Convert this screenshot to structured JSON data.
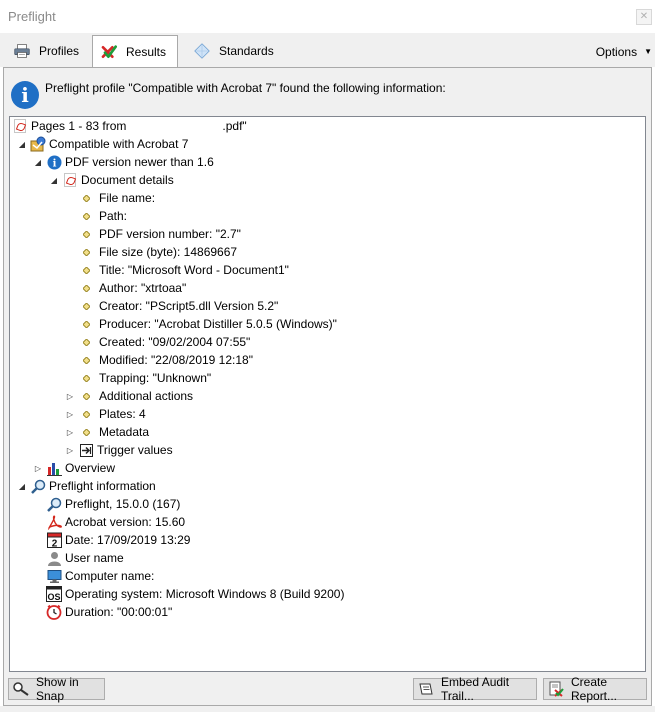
{
  "window": {
    "title": "Preflight"
  },
  "tabs": [
    {
      "label": "Profiles",
      "icon": "printer-icon"
    },
    {
      "label": "Results",
      "icon": "checkmark-cross-icon"
    },
    {
      "label": "Standards",
      "icon": "diamond-icon"
    }
  ],
  "options_label": "Options",
  "info_message": "Preflight profile \"Compatible with Acrobat 7\" found the following information:",
  "tree": {
    "root": {
      "label": "Pages 1 - 83 from",
      "file_suffix": ".pdf\""
    },
    "profile": "Compatible with Acrobat 7",
    "check": "PDF version newer than 1.6",
    "doc_details": "Document details",
    "details": [
      "File name:",
      "Path:",
      "PDF version number: \"2.7\"",
      "File size (byte): 14869667",
      "Title: \"Microsoft Word - Document1\"",
      "Author: \"xtrtoaa\"",
      "Creator: \"PScript5.dll Version 5.2\"",
      "Producer: \"Acrobat Distiller 5.0.5 (Windows)\"",
      "Created: \"09/02/2004 07:55\"",
      "Modified: \"22/08/2019 12:18\"",
      "Trapping: \"Unknown\""
    ],
    "collapsed": [
      "Additional actions",
      "Plates: 4",
      "Metadata"
    ],
    "trigger_values": "Trigger values",
    "overview": "Overview",
    "preflight_info": "Preflight information",
    "info_items": [
      {
        "label": "Preflight, 15.0.0 (167)",
        "icon": "magnifier-icon"
      },
      {
        "label": "Acrobat version: 15.60",
        "icon": "acrobat-icon"
      },
      {
        "label": "Date: 17/09/2019 13:29",
        "icon": "calendar-icon",
        "icon_text": "2"
      },
      {
        "label": "User name",
        "icon": "user-icon"
      },
      {
        "label": "Computer name:",
        "icon": "computer-icon"
      },
      {
        "label": "Operating system: Microsoft Windows 8 (Build 9200)",
        "icon": "os-icon",
        "icon_text": "OS"
      },
      {
        "label": "Duration: \"00:00:01\"",
        "icon": "clock-icon"
      }
    ]
  },
  "buttons": {
    "show_in_snap": "Show in Snap",
    "embed_audit": "Embed Audit Trail...",
    "create_report": "Create Report..."
  }
}
